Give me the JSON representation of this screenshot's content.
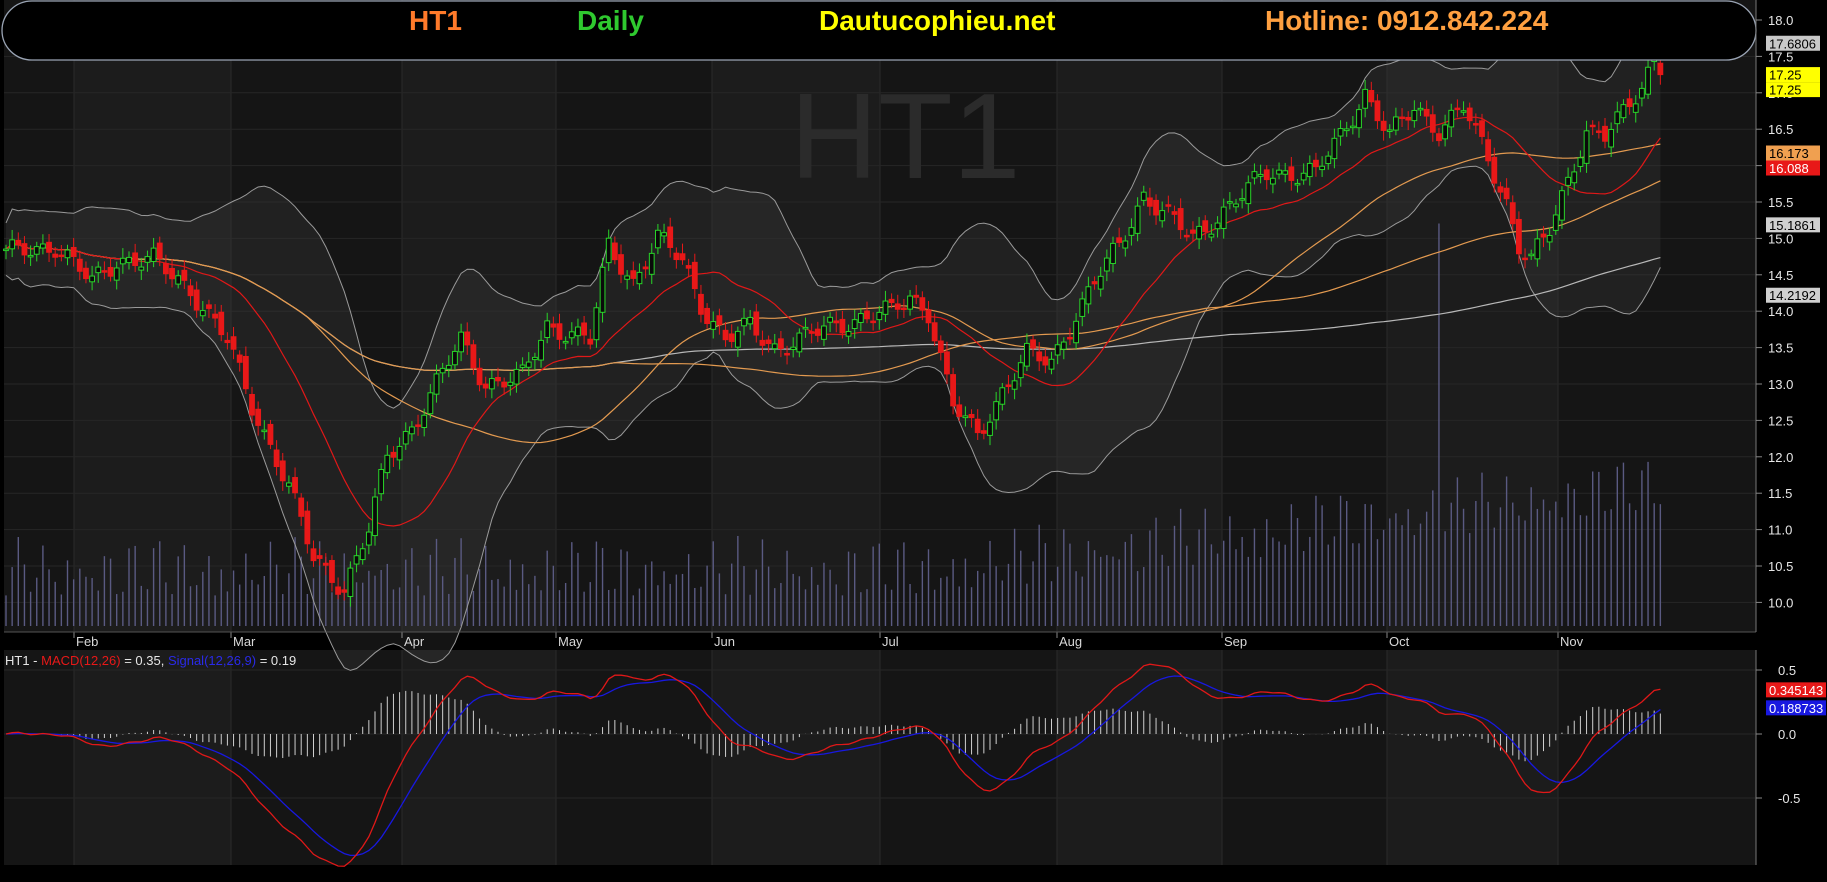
{
  "header": {
    "symbol": "HT1",
    "period": "Daily",
    "site": "Dautucophieu.net",
    "hotline": "Hotline: 0912.842.224",
    "colors": {
      "symbol": "#ff7a2a",
      "period": "#2fc92f",
      "site": "#ffff00",
      "hotline": "#ffa040"
    }
  },
  "watermark": "HT1",
  "macd_legend": {
    "symbol": "HT1",
    "sep": " - ",
    "macd_label": "MACD(12,26)",
    "macd_value": " = 0.35, ",
    "signal_label": "Signal(12,26,9)",
    "signal_value": " = 0.19"
  },
  "chart_data": [
    {
      "type": "candlestick",
      "title": "HT1",
      "months": [
        "Feb",
        "Mar",
        "Apr",
        "May",
        "Jun",
        "Jul",
        "Aug",
        "Sep",
        "Oct",
        "Nov"
      ],
      "yticks": [
        "18.0",
        "17.5",
        "17.0",
        "16.5",
        "16.0",
        "15.5",
        "15.0",
        "14.5",
        "14.0",
        "13.5",
        "13.0",
        "12.5",
        "12.0",
        "11.5",
        "11.0",
        "10.5",
        "10.0"
      ],
      "ylim": [
        9.6,
        18.1
      ],
      "price_keypoints": [
        [
          0,
          14.8
        ],
        [
          8,
          14.9
        ],
        [
          14,
          14.4
        ],
        [
          18,
          14.7
        ],
        [
          24,
          14.7
        ],
        [
          30,
          14.3
        ],
        [
          36,
          13.6
        ],
        [
          40,
          12.7
        ],
        [
          46,
          11.6
        ],
        [
          50,
          10.6
        ],
        [
          55,
          10.2
        ],
        [
          59,
          11.0
        ],
        [
          62,
          12.0
        ],
        [
          66,
          12.4
        ],
        [
          70,
          13.0
        ],
        [
          74,
          13.6
        ],
        [
          78,
          13.0
        ],
        [
          84,
          13.1
        ],
        [
          88,
          13.8
        ],
        [
          92,
          13.7
        ],
        [
          95,
          13.6
        ],
        [
          98,
          14.9
        ],
        [
          102,
          14.4
        ],
        [
          106,
          15.0
        ],
        [
          110,
          14.7
        ],
        [
          113,
          14.1
        ],
        [
          117,
          13.6
        ],
        [
          121,
          13.8
        ],
        [
          125,
          13.5
        ],
        [
          129,
          13.6
        ],
        [
          134,
          13.8
        ],
        [
          139,
          13.9
        ],
        [
          144,
          14.0
        ],
        [
          147,
          14.2
        ],
        [
          150,
          14.0
        ],
        [
          154,
          12.7
        ],
        [
          158,
          12.3
        ],
        [
          162,
          12.9
        ],
        [
          166,
          13.4
        ],
        [
          170,
          13.3
        ],
        [
          173,
          13.8
        ],
        [
          177,
          14.4
        ],
        [
          181,
          14.9
        ],
        [
          185,
          15.6
        ],
        [
          189,
          15.3
        ],
        [
          193,
          15.0
        ],
        [
          197,
          15.3
        ],
        [
          201,
          15.6
        ],
        [
          205,
          15.9
        ],
        [
          209,
          15.9
        ],
        [
          213,
          15.9
        ],
        [
          217,
          16.4
        ],
        [
          221,
          17.0
        ],
        [
          225,
          16.4
        ],
        [
          229,
          16.8
        ],
        [
          233,
          16.5
        ],
        [
          237,
          16.8
        ],
        [
          241,
          16.1
        ],
        [
          244,
          15.5
        ],
        [
          246,
          14.9
        ],
        [
          248,
          14.7
        ],
        [
          251,
          15.1
        ],
        [
          254,
          15.8
        ],
        [
          257,
          16.5
        ],
        [
          260,
          16.4
        ],
        [
          263,
          16.7
        ],
        [
          266,
          17.1
        ],
        [
          268,
          17.5
        ],
        [
          269,
          17.25
        ]
      ],
      "series": [
        {
          "name": "Close",
          "last": 17.25,
          "color": "#ffff00"
        },
        {
          "name": "SMA20",
          "last": 16.088,
          "color": "#e01818"
        },
        {
          "name": "SMA50",
          "last": 16.173,
          "color": "#e39a50"
        },
        {
          "name": "SMA100",
          "last": 15.1861,
          "color": "#e39a50"
        },
        {
          "name": "SMA200",
          "last": 14.2192,
          "color": "#b8b8b8"
        },
        {
          "name": "Bollinger upper",
          "last": 17.6806,
          "color": "#9a9a9a"
        },
        {
          "name": "Bollinger lower",
          "last": null,
          "color": "#9a9a9a"
        },
        {
          "name": "Volume",
          "last": null,
          "color": "#5a5a82"
        }
      ],
      "last_labels": [
        "17.6806",
        "17.25",
        "17.25",
        "16.173",
        "16.088",
        "15.1861",
        "14.2192"
      ]
    },
    {
      "type": "line",
      "title": "HT1 - MACD(12,26) = 0.35, Signal(12,26,9) = 0.19",
      "yticks": [
        "0.5",
        "0.0",
        "-0.5"
      ],
      "ylim": [
        -1.0,
        0.6
      ],
      "series": [
        {
          "name": "MACD(12,26)",
          "last": 0.35,
          "color": "#e01818"
        },
        {
          "name": "Signal(12,26,9)",
          "last": 0.19,
          "color": "#1818e0"
        },
        {
          "name": "Histogram",
          "last": 0.16,
          "color": "#cfcfcf"
        }
      ],
      "last_labels": [
        "0.345143",
        "0.188733"
      ]
    }
  ]
}
